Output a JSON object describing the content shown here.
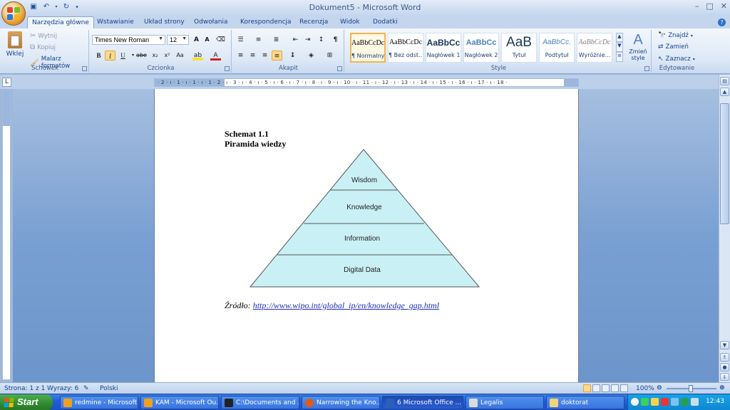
{
  "window": {
    "title": "Dokument5 - Microsoft Word",
    "controls": [
      "–",
      "□",
      "✕"
    ]
  },
  "tabs": [
    "Narzędzia główne",
    "Wstawianie",
    "Układ strony",
    "Odwołania",
    "Korespondencja",
    "Recenzja",
    "Widok",
    "Dodatki"
  ],
  "ribbon": {
    "clipboard": {
      "label": "Schowek",
      "paste": "Wklej",
      "cut": "Wytnij",
      "copy": "Kopiuj",
      "format_painter": "Malarz formatów"
    },
    "font": {
      "label": "Czcionka",
      "font_name": "Times New Roman",
      "font_size": "12"
    },
    "paragraph": {
      "label": "Akapit"
    },
    "styles": {
      "label": "Style",
      "items": [
        {
          "sample": "AaBbCcDc",
          "name": "¶ Normalny"
        },
        {
          "sample": "AaBbCcDc",
          "name": "¶ Bez odst..."
        },
        {
          "sample": "AaBbCc",
          "name": "Nagłówek 1"
        },
        {
          "sample": "AaBbCc",
          "name": "Nagłówek 2"
        },
        {
          "sample": "AaB",
          "name": "Tytuł"
        },
        {
          "sample": "AaBbCc.",
          "name": "Podtytuł"
        },
        {
          "sample": "AaBbCcDc",
          "name": "Wyróżnie..."
        }
      ],
      "change_styles": "Zmień style"
    },
    "editing": {
      "label": "Edytowanie",
      "find": "Znajdź",
      "replace": "Zamień",
      "select": "Zaznacz"
    }
  },
  "ruler": {
    "numbers": "· 2 · ı · 1 · ı · 1 · ı · 1 · 2 · ı · 3 · ı · 4 · ı · 5 · ı · 6 · ı · 7 · ı · 8 · ı · 9 · ı · 10 · ı · 11 · ı · 12 · ı · 13 · ı · 14 · ı · 15 · ı · 16 · ı · 17 · ı · 18 ·"
  },
  "document": {
    "heading_line1": "Schemat 1.1",
    "heading_line2": "Piramida wiedzy",
    "pyramid_levels": [
      "Wisdom",
      "Knowledge",
      "Information",
      "Digital Data"
    ],
    "source_label": "Źródło:",
    "source_link": "http://www.wipo.int/global_ip/en/knowledge_gap.html"
  },
  "status": {
    "page": "Strona: 1 z 1",
    "words": "Wyrazy: 6",
    "language": "Polski",
    "zoom": "100%"
  },
  "taskbar": {
    "start": "Start",
    "items": [
      {
        "label": "redmine - Microsoft ...",
        "color": "#f0a020"
      },
      {
        "label": "KAM - Microsoft Ou...",
        "color": "#f0a020"
      },
      {
        "label": "C:\\Documents and ...",
        "color": "#222222"
      },
      {
        "label": "Narrowing the Kno...",
        "color": "#e05a1a"
      },
      {
        "label": "6 Microsoft Office ...",
        "color": "#2b5fb8"
      },
      {
        "label": "Legalis",
        "color": "#dcdcdc"
      },
      {
        "label": "doktorat",
        "color": "#f2d27a"
      }
    ],
    "clock": "12:43"
  }
}
